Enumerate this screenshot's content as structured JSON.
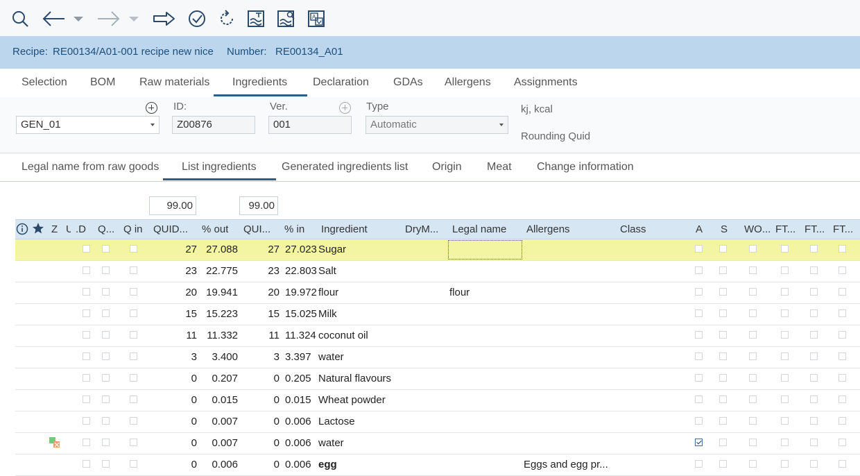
{
  "toolbar": {
    "icons": [
      "search-icon",
      "back-arrow-icon",
      "back-dropdown-icon",
      "forward-arrow-icon",
      "forward-dropdown-icon",
      "proceed-arrow-icon",
      "check-icon",
      "refresh-icon",
      "chart-icon",
      "chart-search-icon",
      "translate-icon"
    ]
  },
  "header": {
    "recipe_label": "Recipe:",
    "recipe_value": "RE00134/A01-001 recipe new nice",
    "number_label": "Number:",
    "number_value": "RE00134_A01"
  },
  "tabs": [
    "Selection",
    "BOM",
    "Raw materials",
    "Ingredients",
    "Declaration",
    "GDAs",
    "Allergens",
    "Assignments"
  ],
  "active_tab": "Ingredients",
  "form": {
    "variant_value": "GEN_01",
    "id_label": "ID:",
    "id_value": "Z00876",
    "ver_label": "Ver.",
    "ver_value": "001",
    "type_label": "Type",
    "type_value": "Automatic",
    "energy_text": "kj, kcal",
    "rounding_text": "Rounding Quid"
  },
  "subtabs": [
    "Legal name from raw goods",
    "List ingredients",
    "Generated ingredients list",
    "Origin",
    "Meat",
    "Change information"
  ],
  "active_subtab": "List ingredients",
  "totals": {
    "out_total": "99.00",
    "in_total": "99.00"
  },
  "grid": {
    "headers": {
      "z": "Z",
      "u": "U",
      "d": "D...",
      "q": "Q...",
      "qin": "Q in",
      "quid_out": "QUID...",
      "pct_out": "% out",
      "quid_in": "QUI...",
      "pct_in": "% in",
      "ingredient": "Ingredient",
      "drym": "DryM...",
      "legal": "Legal name",
      "allergens": "Allergens",
      "class": "Class",
      "a": "A",
      "s": "S",
      "wo": "WO...",
      "ft1": "FT...",
      "ft2": "FT...",
      "ft3": "FT..."
    },
    "rows": [
      {
        "quid_out": "27",
        "pct_out": "27.088",
        "quid_in": "27",
        "pct_in": "27.023",
        "ingredient": "Sugar",
        "legal": "",
        "allergens": "",
        "a": false,
        "bold": false,
        "selected": true,
        "icon": false
      },
      {
        "quid_out": "23",
        "pct_out": "22.775",
        "quid_in": "23",
        "pct_in": "22.803",
        "ingredient": "Salt",
        "legal": "",
        "allergens": "",
        "a": false,
        "bold": false,
        "selected": false,
        "icon": false
      },
      {
        "quid_out": "20",
        "pct_out": "19.941",
        "quid_in": "20",
        "pct_in": "19.972",
        "ingredient": "flour",
        "legal": "flour",
        "allergens": "",
        "a": false,
        "bold": false,
        "selected": false,
        "icon": false
      },
      {
        "quid_out": "15",
        "pct_out": "15.223",
        "quid_in": "15",
        "pct_in": "15.025",
        "ingredient": "Milk",
        "legal": "",
        "allergens": "",
        "a": false,
        "bold": false,
        "selected": false,
        "icon": false
      },
      {
        "quid_out": "11",
        "pct_out": "11.332",
        "quid_in": "11",
        "pct_in": "11.324",
        "ingredient": "coconut oil",
        "legal": "",
        "allergens": "",
        "a": false,
        "bold": false,
        "selected": false,
        "icon": false
      },
      {
        "quid_out": "3",
        "pct_out": "3.400",
        "quid_in": "3",
        "pct_in": "3.397",
        "ingredient": "water",
        "legal": "",
        "allergens": "",
        "a": false,
        "bold": false,
        "selected": false,
        "icon": false
      },
      {
        "quid_out": "0",
        "pct_out": "0.207",
        "quid_in": "0",
        "pct_in": "0.205",
        "ingredient": "Natural flavours",
        "legal": "",
        "allergens": "",
        "a": false,
        "bold": false,
        "selected": false,
        "icon": false
      },
      {
        "quid_out": "0",
        "pct_out": "0.015",
        "quid_in": "0",
        "pct_in": "0.015",
        "ingredient": "Wheat powder",
        "legal": "",
        "allergens": "",
        "a": false,
        "bold": false,
        "selected": false,
        "icon": false
      },
      {
        "quid_out": "0",
        "pct_out": "0.007",
        "quid_in": "0",
        "pct_in": "0.006",
        "ingredient": "Lactose",
        "legal": "",
        "allergens": "",
        "a": false,
        "bold": false,
        "selected": false,
        "icon": false
      },
      {
        "quid_out": "0",
        "pct_out": "0.007",
        "quid_in": "0",
        "pct_in": "0.006",
        "ingredient": "water",
        "legal": "",
        "allergens": "",
        "a": true,
        "bold": false,
        "selected": false,
        "icon": true
      },
      {
        "quid_out": "0",
        "pct_out": "0.006",
        "quid_in": "0",
        "pct_in": "0.006",
        "ingredient": "egg",
        "legal": "",
        "allergens": "Eggs and egg pr...",
        "a": false,
        "bold": true,
        "selected": false,
        "icon": false
      }
    ]
  },
  "colors": {
    "header_bg": "#bcd6ee",
    "accent": "#2b5d8a",
    "selected_row": "#f4f5a2",
    "grid_header": "#d7e6f3"
  }
}
